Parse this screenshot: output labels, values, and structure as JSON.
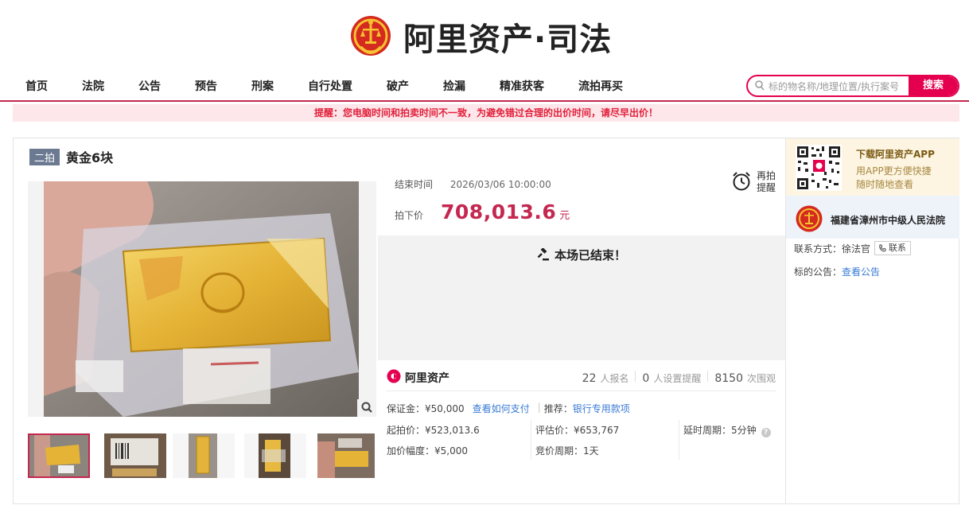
{
  "brand": {
    "title": "阿里资产·司法",
    "accent": "#e4004f"
  },
  "nav": {
    "items": [
      "首页",
      "法院",
      "公告",
      "预告",
      "刑案",
      "自行处置",
      "破产",
      "捡漏",
      "精准获客",
      "流拍再买"
    ]
  },
  "search": {
    "placeholder": "标的物名称/地理位置/执行案号",
    "button": "搜索"
  },
  "notice": "提醒：您电脑时间和拍卖时间不一致，为避免错过合理的出价时间，请尽早出价！",
  "item": {
    "round_badge": "二拍",
    "title": "黄金6块",
    "end_label": "结束时间",
    "end_time": "2026/03/06 10:00:00",
    "price_label": "拍下价",
    "price": "708,013.6",
    "price_unit": "元",
    "remind_label": "再拍提醒",
    "ended_text": "本场已结束！"
  },
  "stats": {
    "logo_text": "阿里资产",
    "signups": "22",
    "signups_label": "人报名",
    "reminders": "0",
    "reminders_label": "人设置提醒",
    "views": "8150",
    "views_label": "次围观"
  },
  "details": {
    "deposit": "保证金：¥50,000",
    "deposit_link": "查看如何支付",
    "recommend_label": "推荐：",
    "recommend_link": "银行专用款项",
    "start_price": "起拍价：¥523,013.6",
    "increment": "加价幅度：¥5,000",
    "appraisal": "评估价：¥653,767",
    "bid_period": "竞价周期：1天",
    "delay_period": "延时周期：5分钟"
  },
  "sidebar": {
    "app_title": "下载阿里资产APP",
    "app_line1": "用APP更方便快捷",
    "app_line2": "随时随地查看",
    "court_name": "福建省漳州市中级人民法院",
    "contact_label": "联系方式：徐法官",
    "contact_button": "联系",
    "announcement_label": "标的公告：",
    "announcement_link": "查看公告"
  }
}
